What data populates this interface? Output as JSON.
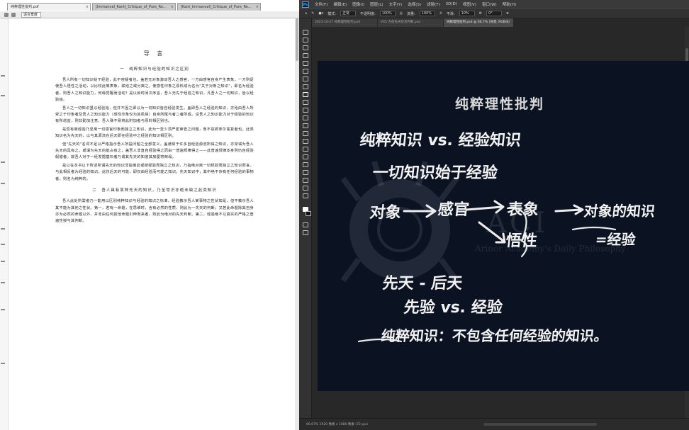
{
  "pdf_viewer": {
    "tabs": [
      {
        "title": "纯粹理性批判.pdf",
        "active": true
      },
      {
        "title": "[Immanuel_Kant]_Critique_of_Pure_Re...",
        "active": false
      },
      {
        "title": "[Kant_Immanuel]_Critique_of_Pure_Re...",
        "active": false
      }
    ],
    "zoom_value": "适合宽度",
    "page": {
      "title": "导 言",
      "section1_heading": "一　纯粹知识与经验的知识之区别",
      "paragraphs": [
        "吾人所有一切知识始于经验，此不容疑者也。盖若无对象激动吾人之感官，一方由感官自身产生表象，一方则促使吾人悟性之活动，以比较此等表象，联结之或分离之，使感性印象之原料成为名为\"关于对象之知识\"，即名为经验者，则吾人之知识能力，何缘觉醒而活动？是以就时间次序言，吾人无先于经验之知识，凡吾人之一切知识，皆以经验始。",
        "吾人之一切知识虽以经验始，但并不因之即以为一切知识皆自经验发生。盖即吾人之经验的知识，亦殆由吾人所受之于印象者及吾人之知识能力（感性印象仅为其机缘）自身所赋与者二者所成。设吾人之知识能力对于经验的知识有所增益，则非勤加注意，吾人殊不易将此附加者与原料相区别也。",
        "是否有离经验乃至离一切感官印象而独立之知识，此为一至少须严密审查之问题，而不容即率尔答复者也。此类知识名为先天的，以与其源流在后天即在经验中之经验的知识相区别。",
        "但\"先天的\"名词不足以严格指示吾人所提问题之全部意义。盖通常于许多自经验源流所得之知识，亦常谓为吾人先天的具有之，或谓为先天的能占有之，盖吾人非直自经验得之而由一普遍规律得之——此普遍规律本身则仍自经验假借者。故吾人对于一经发掘基石者乃谓其先天的知道其房屋将倒塌。",
        "是以在本书以下所述所谓先天的知识非指离此或彼经验而独立之知识，乃指绝对离一切经验而独立之知识而言。与此相反者为经验的知识，此仅后天的可能，即仅由经验而可能之知识。先天知识中，其中绝不杂有任何经验的事物者，则名为纯粹的。"
      ],
      "section2_heading": "二　吾人具有某种先天的知识，乃至常识亦绝未缺之此类知识",
      "paragraphs2": [
        "吾人此处所需者乃一能用以区别纯粹知识与经验的知识之标准。经验教示吾人某事物之性状如是，但不教示吾人其不能为其他之性状。第一，若有一命题，在思维时，含有必然的性质，则此为一先天的判断；又若此命题除其自身亦为必然的命题以外，并非由任何其他命题引伸而来者，则此为绝对的先天判断。第二，经验绝不以真实的严格之普遍性授与其判断。"
      ]
    }
  },
  "photoshop": {
    "app_logo": "Ps",
    "menus": [
      "文件(F)",
      "编辑(E)",
      "图像(I)",
      "图层(L)",
      "文字(Y)",
      "选择(S)",
      "滤镜(T)",
      "3D(D)",
      "视图(V)",
      "窗口(W)",
      "帮助(H)"
    ],
    "options": {
      "mode_label": "模式:",
      "mode_value": "正常",
      "opacity_label": "不透明度:",
      "opacity_value": "100%",
      "flow_label": "流量:",
      "flow_value": "100%",
      "smooth_label": "平滑:",
      "smooth_value": "10%",
      "angle_value": "0°"
    },
    "doc_tabs": [
      {
        "title": "2023-10-27 纯粹理性批判.psd",
        "active": false
      },
      {
        "title": "VX5 为何先天综合判断.psd",
        "active": false
      },
      {
        "title": "纯粹理性批判.psd @ 66.7% (背景, RGB/8)",
        "active": true
      }
    ],
    "status": {
      "zoom": "66.67%",
      "doc_info": "1920 像素 x 1080 像素 (72 ppi)"
    },
    "canvas": {
      "title": "纯粹理性批判",
      "line1": "纯粹知识 vs. 经验知识",
      "line2": "一切知识始于经验",
      "flow_object": "对象",
      "flow_sense": "感官",
      "flow_repr": "表象",
      "flow_understanding": "悟性",
      "flow_result1": "对象的知识",
      "flow_result2": "=经验",
      "line4": "先天 - 后天",
      "line5": "先验 vs. 经验",
      "line6": "纯粹知识：不包含任何经验的知识。",
      "watermark_main": "ACI",
      "watermark_sub": "Arinor Academy's Daily Philosophy"
    }
  }
}
